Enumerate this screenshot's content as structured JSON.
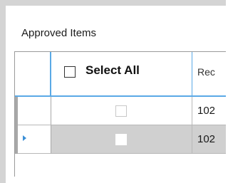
{
  "group": {
    "title": "Approved Items"
  },
  "grid": {
    "header": {
      "select_all_label": "Select All",
      "column2_label": "Rec"
    },
    "rows": [
      {
        "req": "102",
        "checked": false,
        "selected": false
      },
      {
        "req": "102",
        "checked": false,
        "selected": true
      }
    ]
  },
  "colors": {
    "header_accent": "#5aa9e6",
    "selected_row": "#d0d0d0",
    "current_row_arrow": "#3b8fd6"
  }
}
